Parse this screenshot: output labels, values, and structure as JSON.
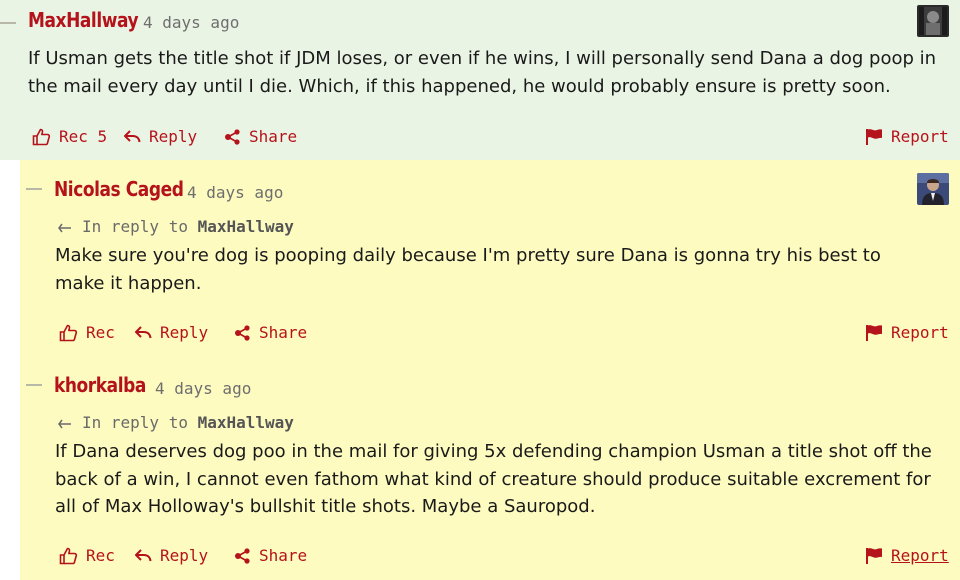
{
  "comments": [
    {
      "author": "MaxHallway",
      "time": "4 days ago",
      "body": "If Usman gets the title shot if JDM loses, or even if he wins, I will personally send Dana a dog poop in the mail every day until I die. Which, if this happened, he would probably ensure is pretty soon.",
      "actions": {
        "rec": "Rec 5",
        "reply": "Reply",
        "share": "Share",
        "report": "Report"
      },
      "avatar_icon": "dark-figure-avatar"
    },
    {
      "author": "Nicolas Caged",
      "time": "4 days ago",
      "in_reply_prefix": "In reply to",
      "in_reply_to": "MaxHallway",
      "body": "Make sure you're dog is pooping daily because I'm pretty sure Dana is gonna try his best to make it happen.",
      "actions": {
        "rec": "Rec",
        "reply": "Reply",
        "share": "Share",
        "report": "Report"
      },
      "avatar_icon": "man-in-suit-avatar"
    },
    {
      "author": "khorkalba",
      "time": "4 days ago",
      "in_reply_prefix": "In reply to",
      "in_reply_to": "MaxHallway",
      "body": "If Dana deserves dog poo in the mail for giving 5x defending champion Usman a title shot off the back of a win, I cannot even fathom what kind of creature should produce suitable excrement for all of Max Holloway's bullshit title shots. Maybe a Sauropod.",
      "actions": {
        "rec": "Rec",
        "reply": "Reply",
        "share": "Share",
        "report": "Report"
      }
    }
  ],
  "colors": {
    "accent": "#b5131b",
    "top_comment_bg": "#eaf4e4",
    "reply_thread_bg": "#fdfbc0"
  }
}
